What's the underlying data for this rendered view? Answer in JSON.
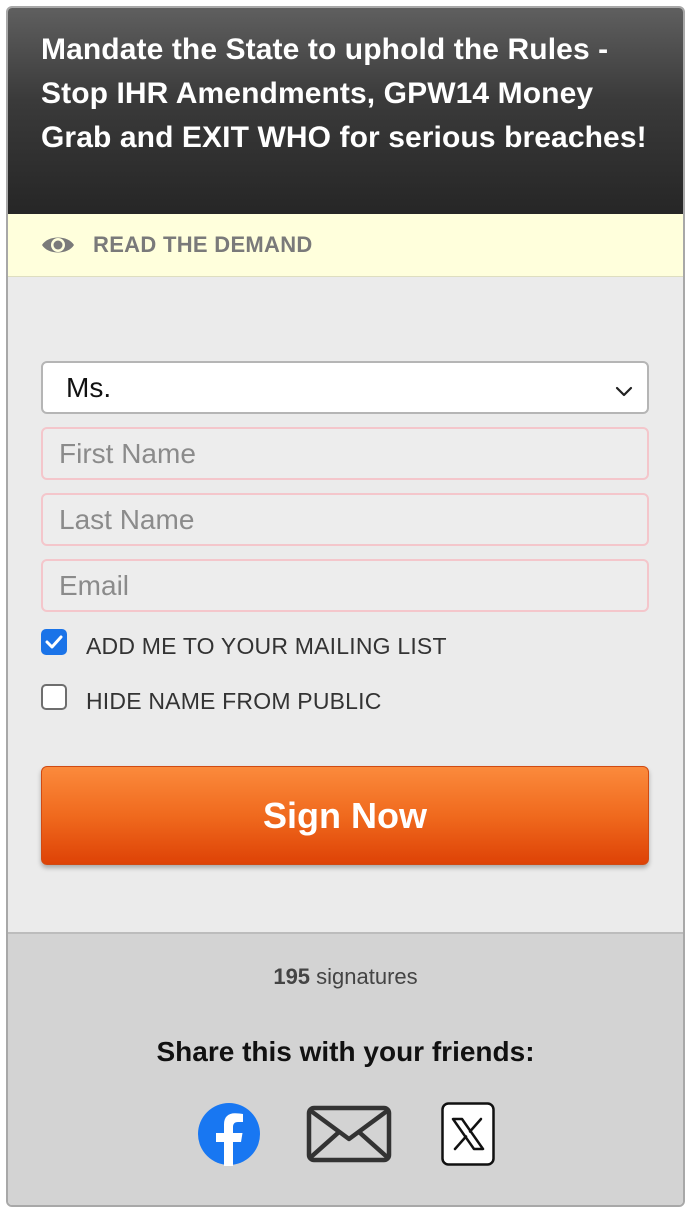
{
  "header": {
    "title": "Mandate the State to uphold the Rules - Stop IHR Amendments, GPW14 Money Grab and EXIT WHO for serious breaches!"
  },
  "demand": {
    "icon": "eye-icon",
    "label": "READ THE DEMAND"
  },
  "form": {
    "title_select": {
      "value": "Ms."
    },
    "first_name": {
      "placeholder": "First Name",
      "value": ""
    },
    "last_name": {
      "placeholder": "Last Name",
      "value": ""
    },
    "email": {
      "placeholder": "Email",
      "value": ""
    },
    "mailing_list": {
      "label": "ADD ME TO YOUR MAILING LIST",
      "checked": true
    },
    "hide_name": {
      "label": "HIDE NAME FROM PUBLIC",
      "checked": false
    },
    "submit_label": "Sign Now"
  },
  "footer": {
    "signature_count": "195",
    "signature_suffix": " signatures",
    "share_title": "Share this with your friends:",
    "share_icons": [
      "facebook-icon",
      "email-icon",
      "x-icon"
    ]
  },
  "colors": {
    "accent": "#f06a1e",
    "checkbox": "#1a73e8",
    "demand_bg": "#ffffdc",
    "facebook": "#1877f2"
  }
}
